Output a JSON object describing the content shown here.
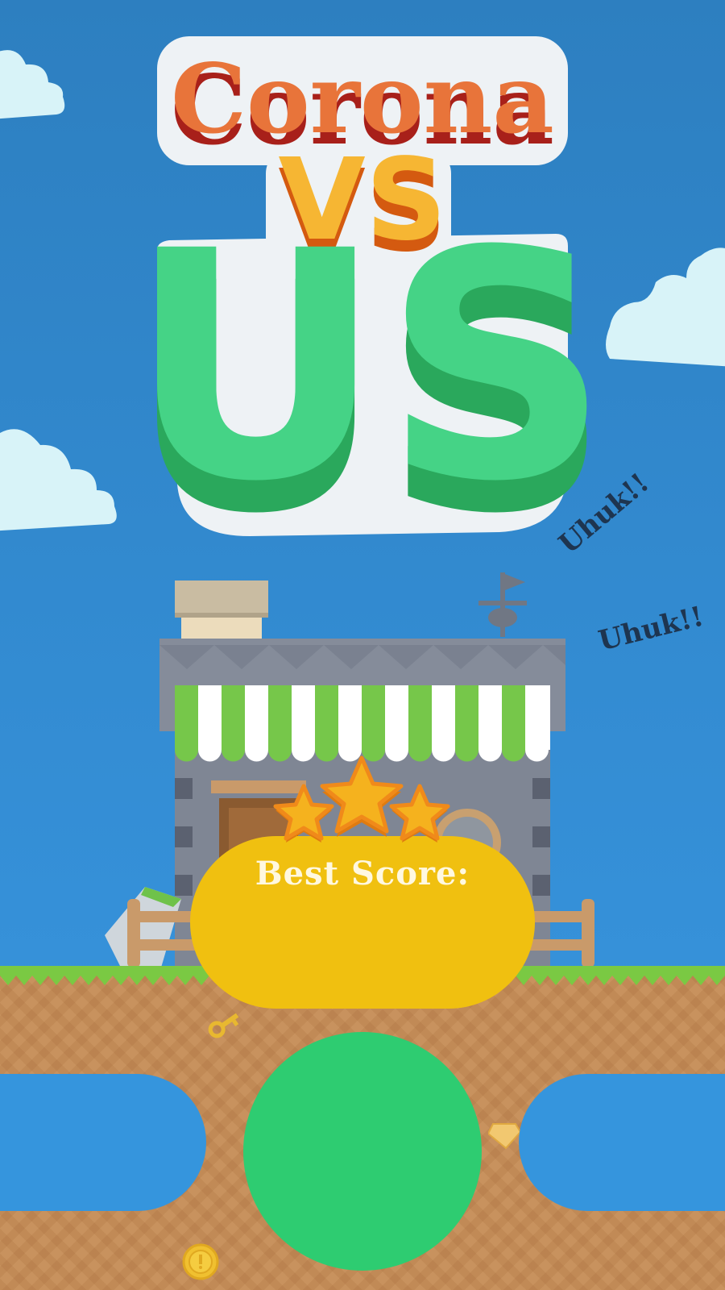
{
  "title": {
    "line1": "Corona",
    "line2": "VS",
    "line3": "US"
  },
  "speech": {
    "cough1": "Uhuk!!",
    "cough2": "Uhuk!!"
  },
  "score": {
    "label": "Best Score:",
    "value": "",
    "stars": 3
  },
  "buttons": {
    "left_label": "",
    "play_label": "",
    "right_label": ""
  },
  "icons": {
    "key": "key-icon",
    "gem": "gem-icon",
    "coin": "coin-icon",
    "weathervane": "weathervane-icon"
  },
  "colors": {
    "sky": "#2d7fc0",
    "title_orange": "#e86a30",
    "title_green": "#3ecf7c",
    "score_panel": "#f0c010",
    "play_button": "#2ecc71",
    "side_buttons": "#3595dd",
    "star": "#f5b21e",
    "ground": "#c8925e",
    "grass": "#7ac943"
  }
}
